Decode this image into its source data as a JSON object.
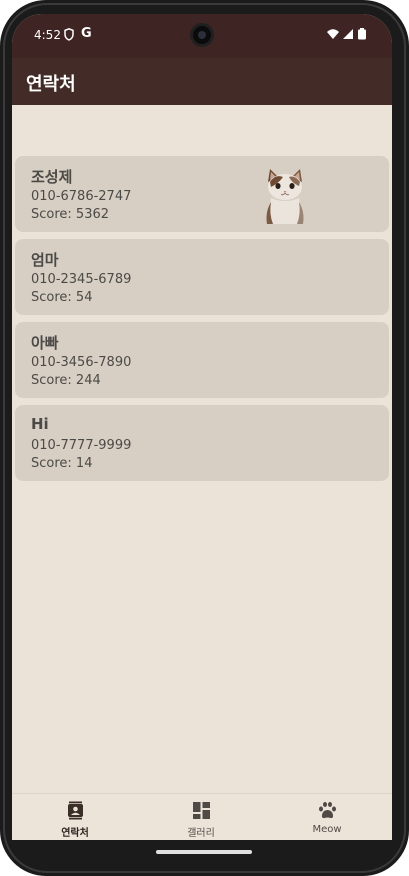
{
  "status_bar": {
    "time": "4:52",
    "google_glyph": "G",
    "icons": [
      "shield-icon",
      "google-icon",
      "wifi-icon",
      "signal-icon",
      "battery-icon"
    ]
  },
  "app_bar": {
    "title": "연락처"
  },
  "contacts": [
    {
      "name": "조성제",
      "phone": "010-6786-2747",
      "score": "Score: 5362",
      "has_photo": true
    },
    {
      "name": "엄마",
      "phone": "010-2345-6789",
      "score": "Score: 54",
      "has_photo": false
    },
    {
      "name": "아빠",
      "phone": "010-3456-7890",
      "score": "Score: 244",
      "has_photo": false
    },
    {
      "name": "Hi",
      "phone": "010-7777-9999",
      "score": "Score: 14",
      "has_photo": false
    }
  ],
  "fab": {
    "label": "+",
    "icon": "add-icon"
  },
  "bottom_nav": {
    "items": [
      {
        "label": "연락처",
        "icon": "contacts-icon",
        "active": true
      },
      {
        "label": "갤러리",
        "icon": "dashboard-icon",
        "active": false
      },
      {
        "label": "Meow",
        "icon": "paw-icon",
        "active": false
      }
    ]
  },
  "colors": {
    "status_bar": "#3e2524",
    "app_bar": "#432b27",
    "background": "#ebe3d8",
    "card": "#d8cfc4",
    "fab": "#4c2f29",
    "bottom_nav": "#ece4d9"
  }
}
